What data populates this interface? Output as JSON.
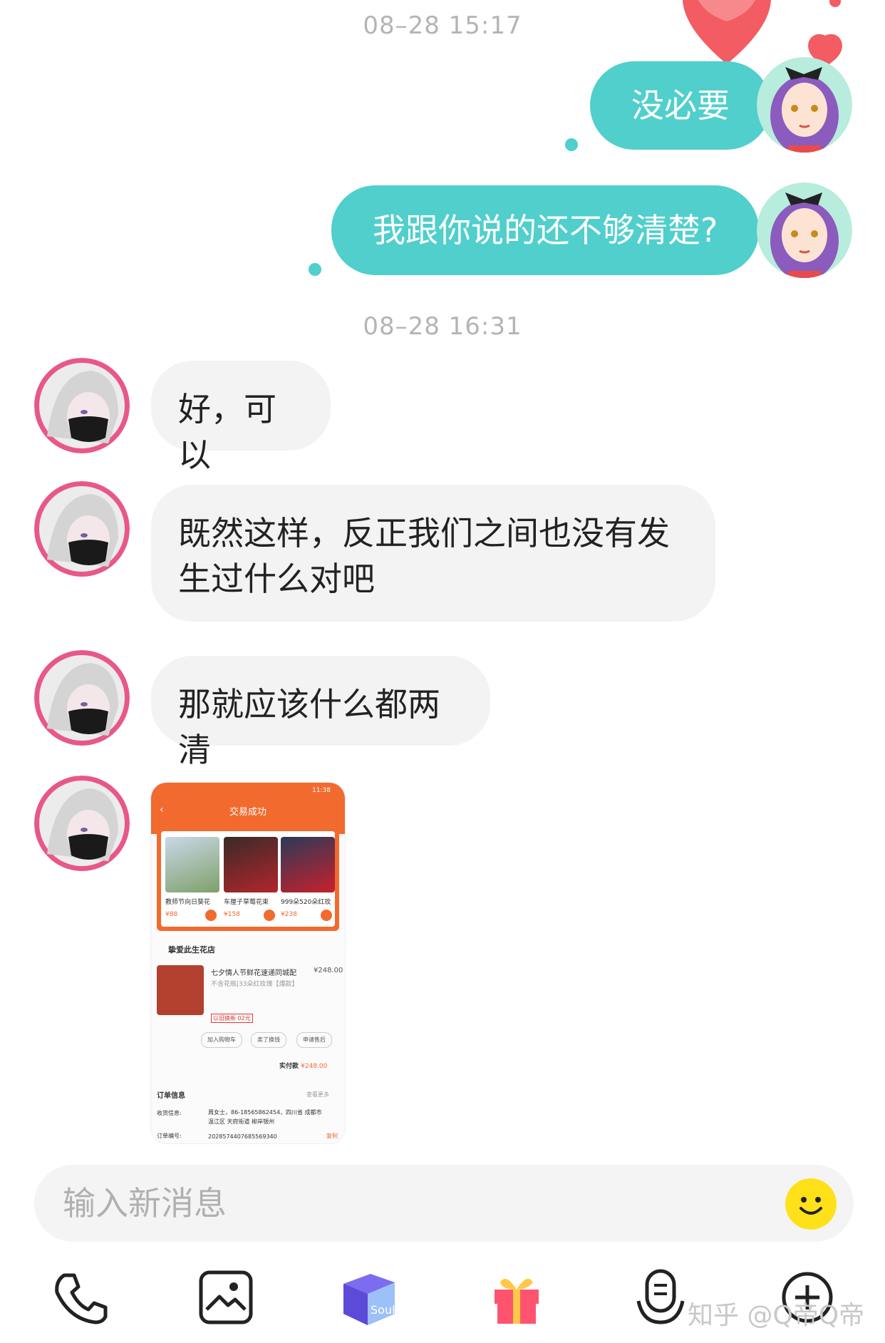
{
  "messages": {
    "ts1": "08–28 15:17",
    "ts2": "08–28 16:31",
    "m1": "没必要",
    "m2": "我跟你说的还不够清楚?",
    "r1": "好，可以",
    "r2": "既然这样，反正我们之间也没有发生过什么对吧",
    "r3": "那就应该什么都两清"
  },
  "image_message": {
    "title": "交易成功",
    "status_time": "11:38",
    "products": [
      {
        "name": "教师节向日葵花",
        "price": "¥88"
      },
      {
        "name": "车厘子草莓花束",
        "price": "¥158"
      },
      {
        "name": "999朵520朵红玫",
        "price": "¥238"
      }
    ],
    "shop_name": "挚爱此生花店",
    "item_name": "七夕情人节鲜花速递同城配",
    "item_price": "¥248.00",
    "item_spec": "不含花瓶|33朵红玫瑰【爆款】",
    "item_tag": "以旧换新 02元",
    "btn_cart": "加入购物车",
    "btn_again": "卖了换钱",
    "btn_after": "申请售后",
    "paid_label": "实付款",
    "paid_value": "¥248.00",
    "order_info": "订单信息",
    "more": "查看更多",
    "receiver_label": "收货信息:",
    "receiver_value": "周女士，86-18565862454，四川省 成都市 温江区 天府街道 柳岸银州",
    "order_no_label": "订单编号:",
    "order_no_value": "2028574407685569340",
    "copy": "复制"
  },
  "input": {
    "placeholder": "输入新消息"
  },
  "toolbar": [
    "phone-icon",
    "photo-icon",
    "soul-box-icon",
    "gift-icon",
    "voice-icon",
    "plus-icon"
  ],
  "watermark": "知乎 @Q帝Q帝",
  "colors": {
    "my_bubble": "#50cfcc",
    "their_bubble": "#f3f3f3",
    "timestamp": "#b4b4b4",
    "emoji": "#ffe11a",
    "heart": "#f25c62"
  }
}
